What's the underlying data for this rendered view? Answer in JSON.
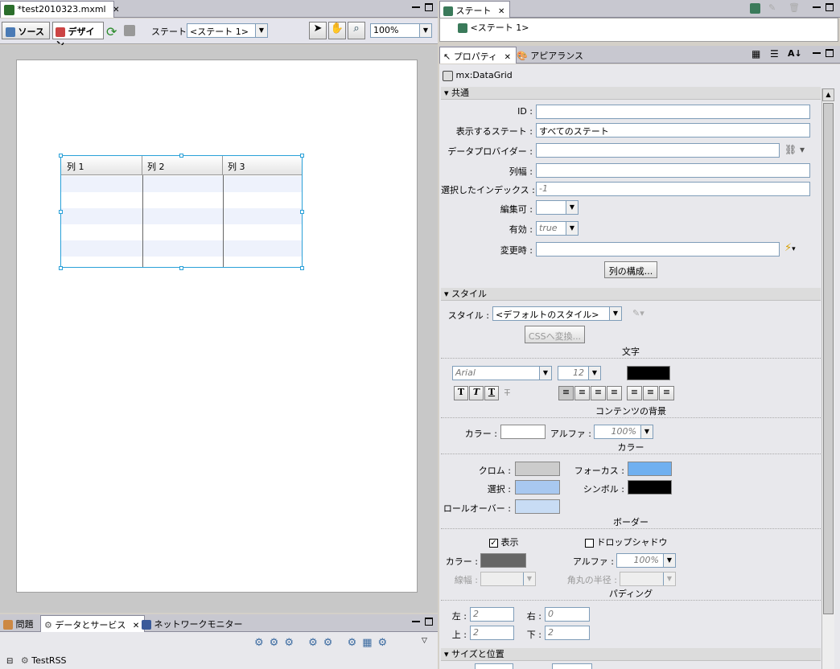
{
  "editor": {
    "tab_title": "*test2010323.mxml",
    "source_label": "ソース",
    "design_label": "デザイン",
    "state_label": "ステート:",
    "state_value": "<ステート 1>",
    "zoom_value": "100%",
    "grid_columns": [
      "列 1",
      "列 2",
      "列 3"
    ]
  },
  "states_panel": {
    "title": "ステート",
    "item": "<ステート 1>"
  },
  "props_panel": {
    "tab_properties": "プロパティ",
    "tab_appearance": "アピアランス",
    "component": "mx:DataGrid",
    "common": {
      "header": "共通",
      "id_label": "ID :",
      "id_value": "",
      "state_label": "表示するステート :",
      "state_value": "すべてのステート",
      "dataprovider_label": "データプロバイダー :",
      "colwidth_label": "列幅 :",
      "selindex_label": "選択したインデックス :",
      "selindex_value": "-1",
      "editable_label": "編集可 :",
      "enabled_label": "有効 :",
      "enabled_value": "true",
      "change_label": "変更時 :",
      "columns_button": "列の構成..."
    },
    "style": {
      "header": "スタイル",
      "style_label": "スタイル :",
      "style_value": "<デフォルトのスタイル>",
      "css_button": "CSSへ変換..."
    },
    "text": {
      "header": "文字",
      "font": "Arial",
      "size": "12",
      "color": "#000000"
    },
    "content_bg": {
      "header": "コンテンツの背景",
      "color_label": "カラー :",
      "alpha_label": "アルファ :",
      "alpha_value": "100%"
    },
    "colors": {
      "header": "カラー",
      "chrome_label": "クロム :",
      "focus_label": "フォーカス :",
      "select_label": "選択 :",
      "symbol_label": "シンボル :",
      "rollover_label": "ロールオーバー :",
      "chrome_color": "#cccccc",
      "focus_color": "#70b0f0",
      "select_color": "#a8c8f0",
      "symbol_color": "#000000",
      "rollover_color": "#c8dcf4"
    },
    "border": {
      "header": "ボーダー",
      "show_label": "表示",
      "shadow_label": "ドロップシャドウ",
      "color_label": "カラー :",
      "alpha_label": "アルファ :",
      "alpha_value": "100%",
      "width_label": "線幅 :",
      "radius_label": "角丸の半径 :",
      "border_color": "#666666"
    },
    "padding": {
      "header": "パディング",
      "left_label": "左 :",
      "left_value": "2",
      "right_label": "右 :",
      "right_value": "0",
      "top_label": "上 :",
      "top_value": "2",
      "bottom_label": "下 :",
      "bottom_value": "2"
    },
    "size": {
      "header": "サイズと位置"
    }
  },
  "bottom_panel": {
    "tab_problems": "問題",
    "tab_data": "データとサービス",
    "tab_network": "ネットワークモニター",
    "tree_item": "TestRSS"
  }
}
